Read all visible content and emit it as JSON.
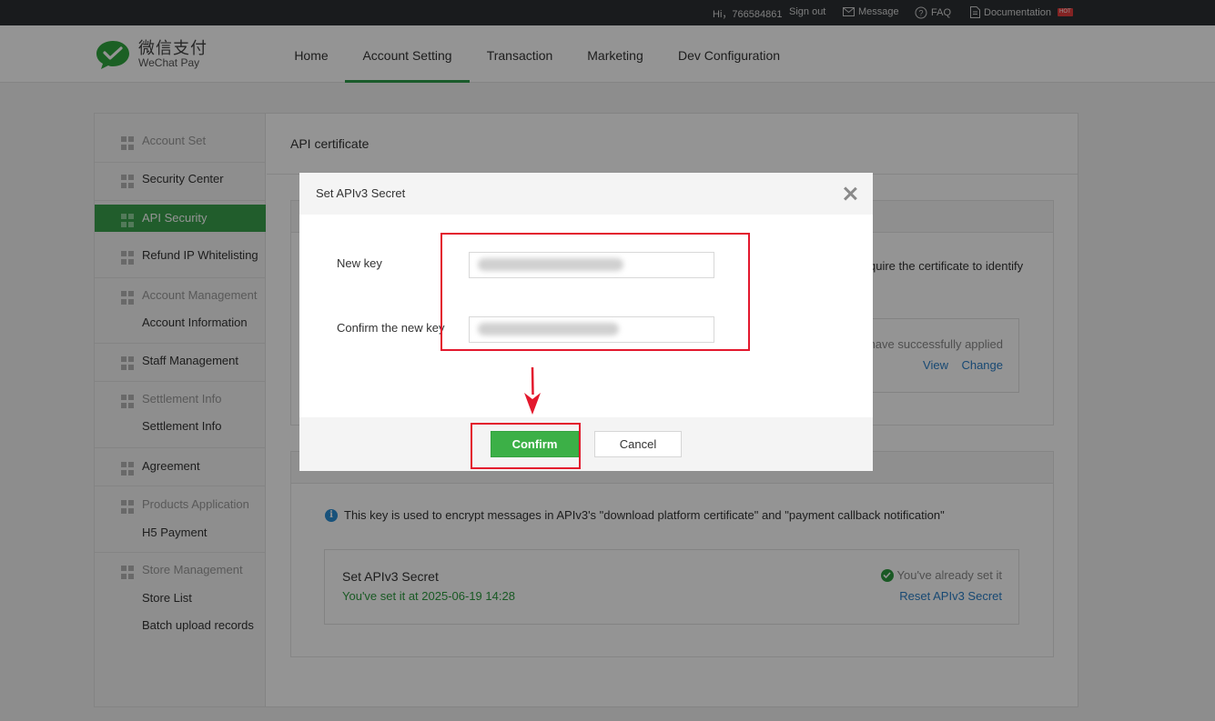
{
  "topbar": {
    "greeting": "Hi，766584861",
    "sign_out": "Sign out",
    "message": "Message",
    "faq": "FAQ",
    "documentation": "Documentation",
    "hot_badge": "HOT"
  },
  "logo": {
    "cn": "微信支付",
    "en": "WeChat Pay",
    "color": "#2fa53e"
  },
  "nav": [
    {
      "label": "Home"
    },
    {
      "label": "Account Setting",
      "active": true
    },
    {
      "label": "Transaction"
    },
    {
      "label": "Marketing"
    },
    {
      "label": "Dev Configuration"
    }
  ],
  "sidebar": {
    "account_set": "Account Set",
    "security_center": "Security Center",
    "api_security": "API Security",
    "refund_ip": "Refund IP Whitelisting",
    "account_management": "Account Management",
    "account_information": "Account Information",
    "staff_management": "Staff Management",
    "settlement_info_head": "Settlement Info",
    "settlement_info": "Settlement Info",
    "agreement": "Agreement",
    "products_application": "Products Application",
    "h5_payment": "H5 Payment",
    "store_management": "Store Management",
    "store_list": "Store List",
    "batch_upload": "Batch upload records"
  },
  "content": {
    "title": "API certificate",
    "cert_desc_fragment": "quire the certificate to identify",
    "cert_status_fragment": "have successfully applied",
    "view_link": "View",
    "change_link": "Change",
    "info_text": "This key is used to encrypt messages in APIv3's \"download platform certificate\" and \"payment callback notification\"",
    "secret_title": "Set APIv3 Secret",
    "secret_date": "You've set it at 2025-06-19 14:28",
    "secret_status": "You've already set it",
    "reset_link": "Reset APIv3 Secret"
  },
  "modal": {
    "title": "Set APIv3 Secret",
    "new_key_label": "New key",
    "confirm_key_label": "Confirm the new key",
    "confirm_button": "Confirm",
    "cancel_button": "Cancel"
  },
  "colors": {
    "accent_green": "#3cb047",
    "link_blue": "#2a7ec6",
    "highlight_red": "#e3182d"
  }
}
